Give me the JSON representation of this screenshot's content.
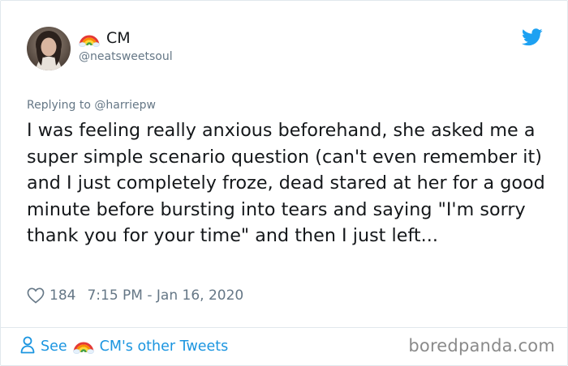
{
  "author": {
    "display_name": "CM",
    "handle": "@neatsweetsoul",
    "name_emoji": "rainbow-icon"
  },
  "reply": {
    "prefix": "Replying to",
    "mention": "@harriepw"
  },
  "tweet": {
    "text": "I was feeling really anxious beforehand, she asked me a super simple scenario question (can't even remember it) and I just completely froze, dead stared at her for a good minute before bursting into tears and saying \"I'm sorry thank you for your time\" and then I just left...",
    "likes": "184",
    "timestamp": "7:15 PM - Jan 16, 2020"
  },
  "footer": {
    "see_label": "See",
    "other_tweets_label": "CM's other Tweets",
    "watermark": "boredpanda.com"
  },
  "colors": {
    "twitter_blue": "#1da1f2",
    "link_blue": "#1b95e0",
    "secondary_text": "#657786",
    "primary_text": "#14171a",
    "border": "#e1e8ed"
  }
}
